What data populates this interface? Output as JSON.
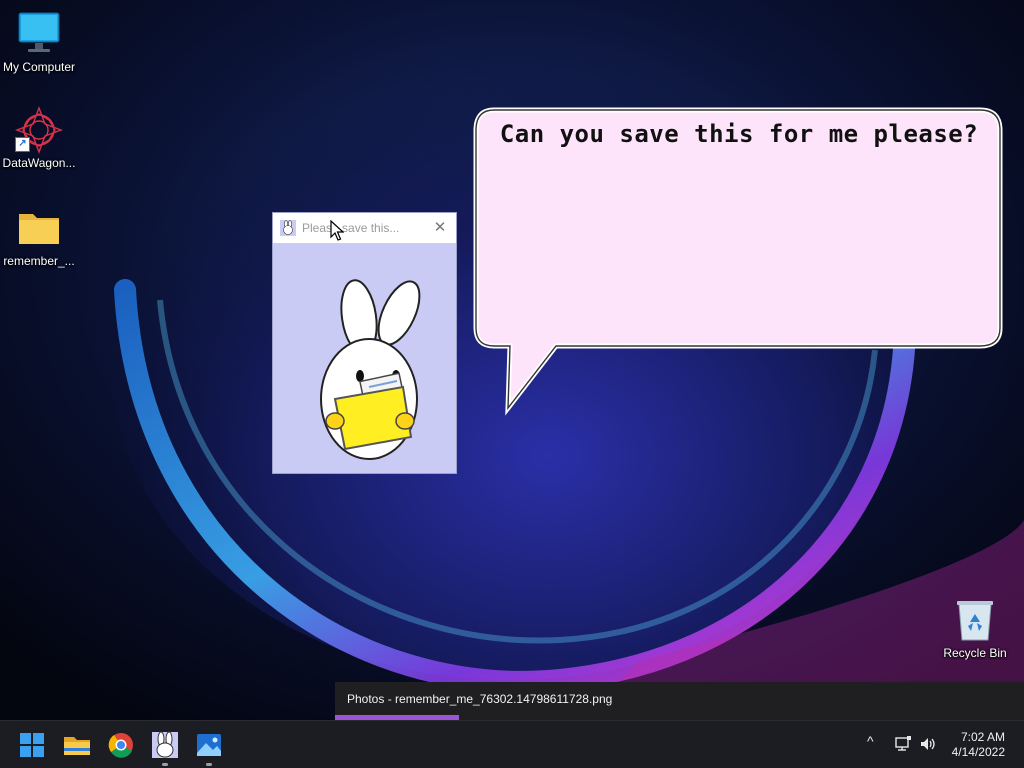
{
  "desktop": {
    "icons": [
      {
        "label": "My Computer"
      },
      {
        "label": "DataWagon..."
      },
      {
        "label": "remember_..."
      }
    ],
    "recycle_bin": {
      "label": "Recycle Bin"
    }
  },
  "dialog": {
    "title": "Please save this...",
    "close_symbol": "✕"
  },
  "bubble": {
    "text": "Can you save this for me please?"
  },
  "toast": {
    "text": "Photos - remember_me_76302.14798611728.png",
    "progress": 0.18
  },
  "taskbar": {
    "apps": [
      "windows-start-icon",
      "file-explorer-icon",
      "chrome-icon",
      "bunny-app-icon",
      "photos-icon"
    ],
    "tray": {
      "chevron": "^",
      "time": "7:02 AM",
      "date": "4/14/2022"
    }
  },
  "colors": {
    "dialog_bg": "#c9cbf5",
    "bubble_fill": "#fde4fb",
    "taskbar_bg": "#1c1d22",
    "toast_progress": "#9b56d6"
  }
}
